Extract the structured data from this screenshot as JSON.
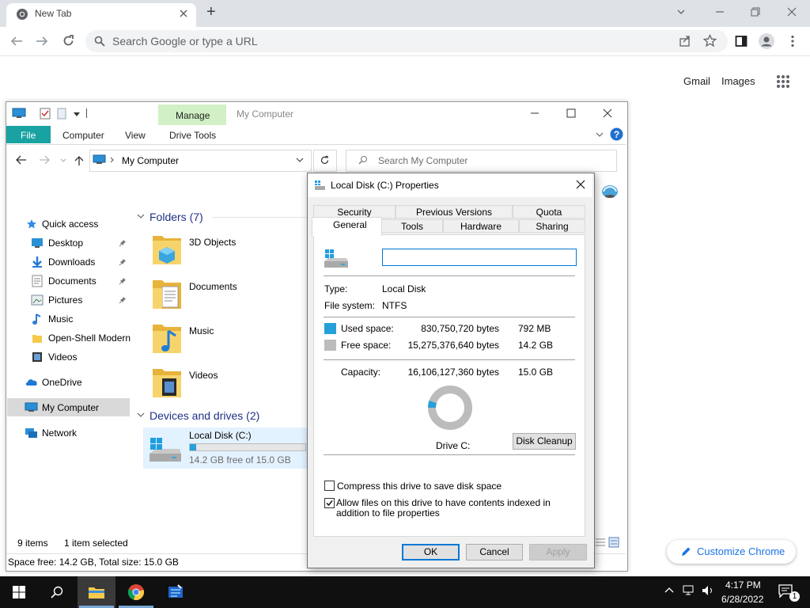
{
  "chrome": {
    "tab_title": "New Tab",
    "new_tab_symbol": "+",
    "omnibox_placeholder": "Search Google or type a URL",
    "links": {
      "gmail": "Gmail",
      "images": "Images"
    },
    "customize_label": "Customize Chrome"
  },
  "explorer": {
    "title": "My Computer",
    "manage_label": "Manage",
    "ribbon_tabs": [
      "File",
      "Computer",
      "View",
      "Drive Tools"
    ],
    "address": "My Computer",
    "search_placeholder": "Search My Computer",
    "nav": {
      "quick_access": "Quick access",
      "items": [
        "Desktop",
        "Downloads",
        "Documents",
        "Pictures",
        "Music",
        "Open-Shell Modern",
        "Videos"
      ],
      "onedrive": "OneDrive",
      "my_computer": "My Computer",
      "network": "Network"
    },
    "folders_header": "Folders (7)",
    "folders": [
      "3D Objects",
      "Documents",
      "Music",
      "Videos"
    ],
    "drives_header": "Devices and drives (2)",
    "drive": {
      "name": "Local Disk (C:)",
      "free_text": "14.2 GB free of 15.0 GB",
      "used_fraction": 0.053
    },
    "status": {
      "items": "9 items",
      "selected": "1 item selected",
      "bottom": "Space free: 14.2 GB, Total size: 15.0 GB"
    }
  },
  "dialog": {
    "title": "Local Disk (C:) Properties",
    "tabs_row1": [
      "Security",
      "Previous Versions",
      "Quota"
    ],
    "tabs_row2": [
      "General",
      "Tools",
      "Hardware",
      "Sharing"
    ],
    "label_input_value": "",
    "type_label": "Type:",
    "type_value": "Local Disk",
    "fs_label": "File system:",
    "fs_value": "NTFS",
    "used_label": "Used space:",
    "used_bytes": "830,750,720 bytes",
    "used_size": "792 MB",
    "free_label": "Free space:",
    "free_bytes": "15,275,376,640 bytes",
    "free_size": "14.2 GB",
    "capacity_label": "Capacity:",
    "capacity_bytes": "16,106,127,360 bytes",
    "capacity_size": "15.0 GB",
    "drive_label": "Drive C:",
    "used_fraction": 0.052,
    "cleanup_button": "Disk Cleanup",
    "compress_label": "Compress this drive to save disk space",
    "compress_checked": false,
    "index_label": "Allow files on this drive to have contents indexed in addition to file properties",
    "index_checked": true,
    "ok": "OK",
    "cancel": "Cancel",
    "apply": "Apply",
    "colors": {
      "used": "#26a0da",
      "free": "#bcbcbc"
    }
  },
  "taskbar": {
    "time": "4:17 PM",
    "date": "6/28/2022",
    "notification_count": "1"
  }
}
